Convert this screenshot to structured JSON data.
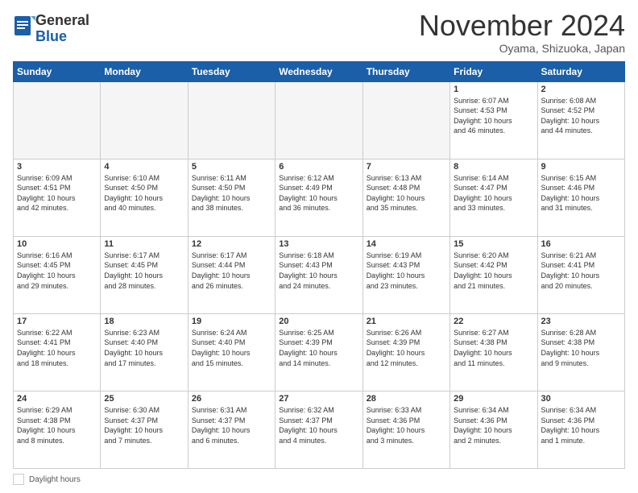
{
  "logo": {
    "general": "General",
    "blue": "Blue"
  },
  "title": "November 2024",
  "location": "Oyama, Shizuoka, Japan",
  "days_of_week": [
    "Sunday",
    "Monday",
    "Tuesday",
    "Wednesday",
    "Thursday",
    "Friday",
    "Saturday"
  ],
  "footer": {
    "legend_label": "Daylight hours"
  },
  "weeks": [
    {
      "days": [
        {
          "num": "",
          "info": "",
          "empty": true
        },
        {
          "num": "",
          "info": "",
          "empty": true
        },
        {
          "num": "",
          "info": "",
          "empty": true
        },
        {
          "num": "",
          "info": "",
          "empty": true
        },
        {
          "num": "",
          "info": "",
          "empty": true
        },
        {
          "num": "1",
          "info": "Sunrise: 6:07 AM\nSunset: 4:53 PM\nDaylight: 10 hours\nand 46 minutes."
        },
        {
          "num": "2",
          "info": "Sunrise: 6:08 AM\nSunset: 4:52 PM\nDaylight: 10 hours\nand 44 minutes."
        }
      ]
    },
    {
      "days": [
        {
          "num": "3",
          "info": "Sunrise: 6:09 AM\nSunset: 4:51 PM\nDaylight: 10 hours\nand 42 minutes."
        },
        {
          "num": "4",
          "info": "Sunrise: 6:10 AM\nSunset: 4:50 PM\nDaylight: 10 hours\nand 40 minutes."
        },
        {
          "num": "5",
          "info": "Sunrise: 6:11 AM\nSunset: 4:50 PM\nDaylight: 10 hours\nand 38 minutes."
        },
        {
          "num": "6",
          "info": "Sunrise: 6:12 AM\nSunset: 4:49 PM\nDaylight: 10 hours\nand 36 minutes."
        },
        {
          "num": "7",
          "info": "Sunrise: 6:13 AM\nSunset: 4:48 PM\nDaylight: 10 hours\nand 35 minutes."
        },
        {
          "num": "8",
          "info": "Sunrise: 6:14 AM\nSunset: 4:47 PM\nDaylight: 10 hours\nand 33 minutes."
        },
        {
          "num": "9",
          "info": "Sunrise: 6:15 AM\nSunset: 4:46 PM\nDaylight: 10 hours\nand 31 minutes."
        }
      ]
    },
    {
      "days": [
        {
          "num": "10",
          "info": "Sunrise: 6:16 AM\nSunset: 4:45 PM\nDaylight: 10 hours\nand 29 minutes."
        },
        {
          "num": "11",
          "info": "Sunrise: 6:17 AM\nSunset: 4:45 PM\nDaylight: 10 hours\nand 28 minutes."
        },
        {
          "num": "12",
          "info": "Sunrise: 6:17 AM\nSunset: 4:44 PM\nDaylight: 10 hours\nand 26 minutes."
        },
        {
          "num": "13",
          "info": "Sunrise: 6:18 AM\nSunset: 4:43 PM\nDaylight: 10 hours\nand 24 minutes."
        },
        {
          "num": "14",
          "info": "Sunrise: 6:19 AM\nSunset: 4:43 PM\nDaylight: 10 hours\nand 23 minutes."
        },
        {
          "num": "15",
          "info": "Sunrise: 6:20 AM\nSunset: 4:42 PM\nDaylight: 10 hours\nand 21 minutes."
        },
        {
          "num": "16",
          "info": "Sunrise: 6:21 AM\nSunset: 4:41 PM\nDaylight: 10 hours\nand 20 minutes."
        }
      ]
    },
    {
      "days": [
        {
          "num": "17",
          "info": "Sunrise: 6:22 AM\nSunset: 4:41 PM\nDaylight: 10 hours\nand 18 minutes."
        },
        {
          "num": "18",
          "info": "Sunrise: 6:23 AM\nSunset: 4:40 PM\nDaylight: 10 hours\nand 17 minutes."
        },
        {
          "num": "19",
          "info": "Sunrise: 6:24 AM\nSunset: 4:40 PM\nDaylight: 10 hours\nand 15 minutes."
        },
        {
          "num": "20",
          "info": "Sunrise: 6:25 AM\nSunset: 4:39 PM\nDaylight: 10 hours\nand 14 minutes."
        },
        {
          "num": "21",
          "info": "Sunrise: 6:26 AM\nSunset: 4:39 PM\nDaylight: 10 hours\nand 12 minutes."
        },
        {
          "num": "22",
          "info": "Sunrise: 6:27 AM\nSunset: 4:38 PM\nDaylight: 10 hours\nand 11 minutes."
        },
        {
          "num": "23",
          "info": "Sunrise: 6:28 AM\nSunset: 4:38 PM\nDaylight: 10 hours\nand 9 minutes."
        }
      ]
    },
    {
      "days": [
        {
          "num": "24",
          "info": "Sunrise: 6:29 AM\nSunset: 4:38 PM\nDaylight: 10 hours\nand 8 minutes."
        },
        {
          "num": "25",
          "info": "Sunrise: 6:30 AM\nSunset: 4:37 PM\nDaylight: 10 hours\nand 7 minutes."
        },
        {
          "num": "26",
          "info": "Sunrise: 6:31 AM\nSunset: 4:37 PM\nDaylight: 10 hours\nand 6 minutes."
        },
        {
          "num": "27",
          "info": "Sunrise: 6:32 AM\nSunset: 4:37 PM\nDaylight: 10 hours\nand 4 minutes."
        },
        {
          "num": "28",
          "info": "Sunrise: 6:33 AM\nSunset: 4:36 PM\nDaylight: 10 hours\nand 3 minutes."
        },
        {
          "num": "29",
          "info": "Sunrise: 6:34 AM\nSunset: 4:36 PM\nDaylight: 10 hours\nand 2 minutes."
        },
        {
          "num": "30",
          "info": "Sunrise: 6:34 AM\nSunset: 4:36 PM\nDaylight: 10 hours\nand 1 minute."
        }
      ]
    }
  ]
}
